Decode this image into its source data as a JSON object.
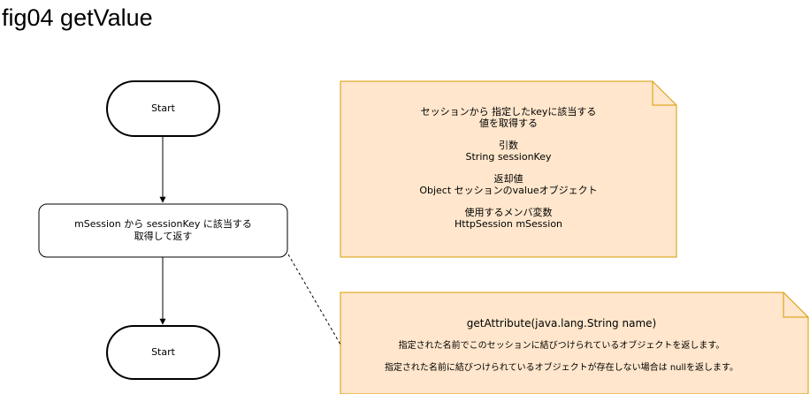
{
  "title": "fig04 getValue",
  "colors": {
    "note_fill": "#ffe6cc",
    "note_stroke": "#d79b00",
    "node_fill": "#ffffff",
    "line": "#000000"
  },
  "flow": {
    "start_label": "Start",
    "process_line1": "mSession から sessionKey に該当する",
    "process_line2": "取得して返す",
    "end_label": "Start"
  },
  "note_top": {
    "desc_line1": "セッションから 指定したkeyに該当する",
    "desc_line2": "値を取得する",
    "arg_heading": "引数",
    "arg_value": "String sessionKey",
    "return_heading": "返却値",
    "return_value": "Object セッションのvalueオブジェクト",
    "member_heading": "使用するメンバ変数",
    "member_value": "HttpSession mSession"
  },
  "note_bottom": {
    "method": "getAttribute(java.lang.String name)",
    "line1": "指定された名前でこのセッションに結びつけられているオブジェクトを返します。",
    "line2": "指定された名前に結びつけられているオブジェクトが存在しない場合は  nullを返します。"
  }
}
